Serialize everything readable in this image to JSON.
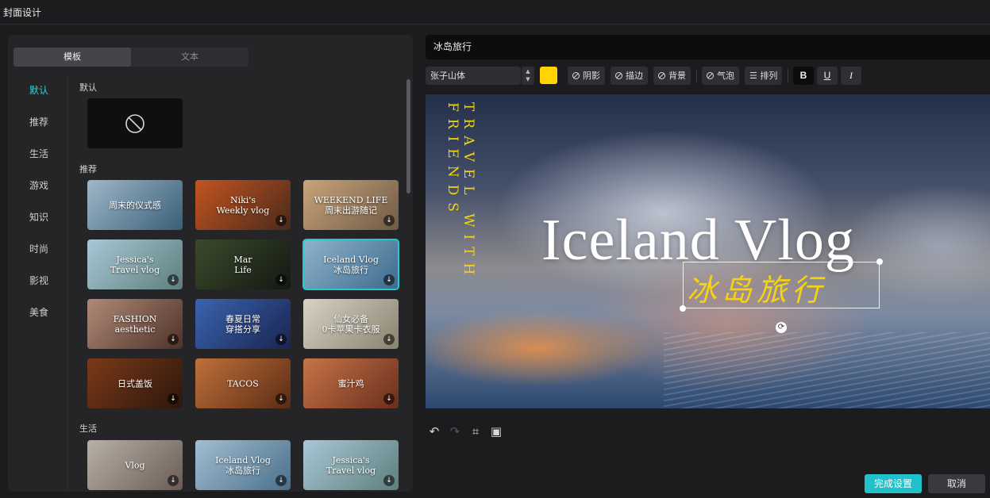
{
  "app": {
    "title": "封面设计"
  },
  "tabs": [
    {
      "label": "模板",
      "active": true
    },
    {
      "label": "文本",
      "active": false
    }
  ],
  "categories": [
    "默认",
    "推荐",
    "生活",
    "游戏",
    "知识",
    "时尚",
    "影视",
    "美食"
  ],
  "active_category": "默认",
  "sections": {
    "default": "默认",
    "recommended": "推荐",
    "life": "生活"
  },
  "recommended_thumbs": [
    {
      "caption": "周末的仪式感",
      "colors": [
        "#9fb8c9",
        "#3a5f78"
      ]
    },
    {
      "caption": "Niki's\nWeekly vlog",
      "colors": [
        "#c3541f",
        "#4a2a1c"
      ]
    },
    {
      "caption": "WEEKEND LIFE\n周末出游随记",
      "colors": [
        "#c9a47a",
        "#6e5a46"
      ]
    },
    {
      "caption": "Jessica's\nTravel vlog",
      "colors": [
        "#a9c7d6",
        "#5d7f7d"
      ]
    },
    {
      "caption": "Mar\nLife",
      "colors": [
        "#3a4a2a",
        "#141813"
      ]
    },
    {
      "caption": "Iceland Vlog\n冰岛旅行",
      "colors": [
        "#8fb4cc",
        "#3d6a8c"
      ],
      "selected": true
    },
    {
      "caption": "FASHION\naesthetic",
      "colors": [
        "#b08a78",
        "#4d3128"
      ]
    },
    {
      "caption": "春夏日常\n穿搭分享",
      "colors": [
        "#3a64b0",
        "#1a2450"
      ]
    },
    {
      "caption": "仙女必备\n0卡苹果卡衣服",
      "colors": [
        "#d8d2c4",
        "#8a8270"
      ]
    },
    {
      "caption": "日式盖饭",
      "colors": [
        "#7a3a18",
        "#2b160c"
      ]
    },
    {
      "caption": "TACOS",
      "colors": [
        "#c0703a",
        "#5a2c14"
      ]
    },
    {
      "caption": "蜜汁鸡",
      "colors": [
        "#c77448",
        "#6a2e1c"
      ]
    }
  ],
  "life_thumbs": [
    {
      "caption": "Vlog",
      "colors": [
        "#b8b0a8",
        "#6a5c54"
      ]
    },
    {
      "caption": "Iceland Vlog\n冰岛旅行",
      "colors": [
        "#a0bed0",
        "#4b6f8c"
      ]
    },
    {
      "caption": "Jessica's\nTravel vlog",
      "colors": [
        "#a9c7d6",
        "#5d7f7d"
      ]
    }
  ],
  "editor": {
    "title_value": "冰岛旅行",
    "font": "张子山体",
    "text_color": "#ffd400",
    "buttons": {
      "shadow": "阴影",
      "stroke": "描边",
      "background": "背景",
      "bubble": "气泡",
      "arrange": "排列"
    },
    "style_buttons": {
      "bold": "B",
      "underline": "U",
      "italic": "I"
    }
  },
  "canvas": {
    "vertical_text": "TRAVEL WITH FRIENDS",
    "main_title": "Iceland Vlog",
    "sub_title": "冰岛旅行"
  },
  "actions": {
    "confirm": "完成设置",
    "cancel": "取消"
  }
}
